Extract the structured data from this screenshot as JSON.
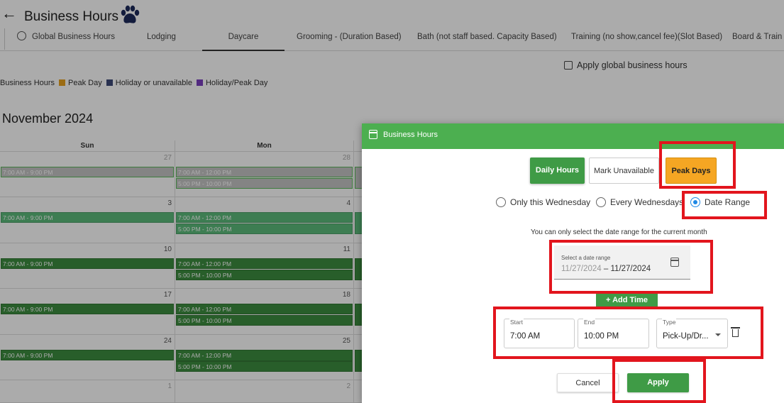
{
  "header": {
    "back_icon": "arrow-left-icon",
    "title": "Business Hours",
    "logo_icon": "paw-icon"
  },
  "tabs": [
    {
      "label": "Global Business Hours",
      "icon": "globe-icon"
    },
    {
      "label": "Lodging"
    },
    {
      "label": "Daycare",
      "active": true
    },
    {
      "label": "Grooming - (Duration Based)"
    },
    {
      "label": "Bath (not staff based. Capacity Based)"
    },
    {
      "label": "Training (no show,cancel fee)(Slot Based)"
    },
    {
      "label": "Board & Train (F"
    }
  ],
  "apply_global_label": "Apply global business hours",
  "legend": {
    "items": [
      {
        "label": "Business Hours",
        "color": ""
      },
      {
        "label": "Peak Day",
        "color": "#e8a21e"
      },
      {
        "label": "Holiday or unavailable",
        "color": "#3e4a78"
      },
      {
        "label": "Holiday/Peak Day",
        "color": "#7b3fbf"
      }
    ]
  },
  "calendar": {
    "month_label": "November 2024",
    "days": [
      "Sun",
      "Mon"
    ],
    "weeks": [
      {
        "sun": {
          "date": "27",
          "events": [
            "7:00 AM - 9:00 PM"
          ]
        },
        "mon": {
          "date": "28",
          "events": [
            "7:00 AM - 12:00 PM",
            "5:00 PM - 10:00 PM"
          ]
        }
      },
      {
        "sun": {
          "date": "3",
          "events": [
            "7:00 AM - 9:00 PM"
          ]
        },
        "mon": {
          "date": "4",
          "events": [
            "7:00 AM - 12:00 PM",
            "5:00 PM - 10:00 PM"
          ]
        }
      },
      {
        "sun": {
          "date": "10",
          "events": [
            "7:00 AM - 9:00 PM"
          ]
        },
        "mon": {
          "date": "11",
          "events": [
            "7:00 AM - 12:00 PM",
            "5:00 PM - 10:00 PM"
          ]
        }
      },
      {
        "sun": {
          "date": "17",
          "events": [
            "7:00 AM - 9:00 PM"
          ]
        },
        "mon": {
          "date": "18",
          "events": [
            "7:00 AM - 12:00 PM",
            "5:00 PM - 10:00 PM"
          ]
        }
      },
      {
        "sun": {
          "date": "24",
          "events": [
            "7:00 AM - 9:00 PM"
          ]
        },
        "mon": {
          "date": "25",
          "events": [
            "7:00 AM - 12:00 PM",
            "5:00 PM - 10:00 PM"
          ]
        }
      },
      {
        "sun": {
          "date": "1",
          "events": []
        },
        "mon": {
          "date": "2",
          "events": []
        }
      }
    ]
  },
  "dialog": {
    "title": "Business Hours",
    "title_icon": "calendar-icon",
    "buttons": {
      "daily": "Daily Hours",
      "mark": "Mark Unavailable",
      "peak": "Peak Days"
    },
    "radios": [
      {
        "label": "Only this Wednesday",
        "selected": false
      },
      {
        "label": "Every Wednesdays",
        "selected": false
      },
      {
        "label": "Date Range",
        "selected": true
      }
    ],
    "note": "You can only select the date range for the current month",
    "date_range": {
      "label": "Select a date range",
      "start": "11/27/2024",
      "separator": " – ",
      "end": "11/27/2024",
      "icon": "calendar-icon"
    },
    "add_time_label": "+ Add Time",
    "time_row": {
      "start_label": "Start",
      "start_value": "7:00 AM",
      "end_label": "End",
      "end_value": "10:00 PM",
      "type_label": "Type",
      "type_value": "Pick-Up/Dr...",
      "delete_icon": "trash-icon"
    },
    "cancel_label": "Cancel",
    "apply_label": "Apply"
  }
}
